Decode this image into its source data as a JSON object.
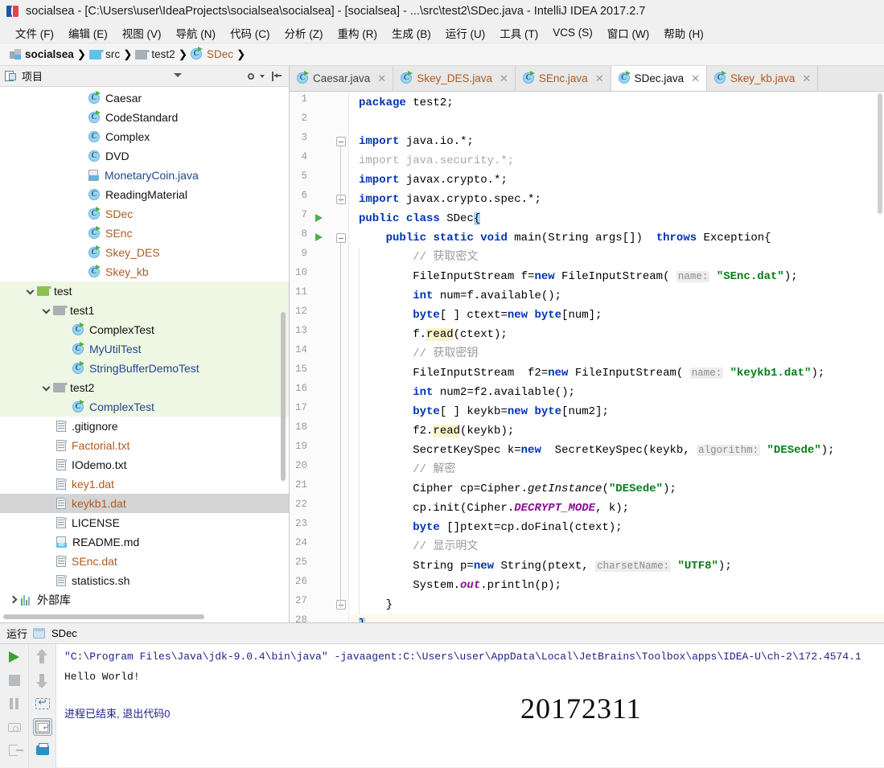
{
  "window": {
    "title": "socialsea - [C:\\Users\\user\\IdeaProjects\\socialsea\\socialsea] - [socialsea] - ...\\src\\test2\\SDec.java - IntelliJ IDEA 2017.2.7",
    "app_icon": "intellij-idea-icon"
  },
  "menubar": {
    "items": [
      "文件 (F)",
      "编辑 (E)",
      "视图 (V)",
      "导航 (N)",
      "代码 (C)",
      "分析 (Z)",
      "重构 (R)",
      "生成 (B)",
      "运行 (U)",
      "工具 (T)",
      "VCS (S)",
      "窗口 (W)",
      "帮助 (H)"
    ]
  },
  "breadcrumb": {
    "items": [
      {
        "label": "socialsea",
        "icon": "module-icon",
        "style": "bold"
      },
      {
        "label": "src",
        "icon": "folder-blue-icon",
        "style": "plain"
      },
      {
        "label": "test2",
        "icon": "folder-gray-icon",
        "style": "plain"
      },
      {
        "label": "SDec",
        "icon": "java-class-icon",
        "style": "orange"
      }
    ]
  },
  "project_panel": {
    "title": "项目",
    "icon": "project-view-icon",
    "dropdown_icon": "chevron-down-icon",
    "settings_icon": "gear-icon",
    "collapse_icon": "collapse-all-icon",
    "tree": [
      {
        "label": "Caesar",
        "icon": "java-class-runnable-icon",
        "indent": 5,
        "color": "dark",
        "bg": "none"
      },
      {
        "label": "CodeStandard",
        "icon": "java-class-runnable-icon",
        "indent": 5,
        "color": "dark",
        "bg": "none"
      },
      {
        "label": "Complex",
        "icon": "java-class-icon",
        "indent": 5,
        "color": "dark",
        "bg": "none"
      },
      {
        "label": "DVD",
        "icon": "java-class-icon",
        "indent": 5,
        "color": "dark",
        "bg": "none"
      },
      {
        "label": "MonetaryCoin.java",
        "icon": "java-file-icon",
        "indent": 5,
        "color": "blue",
        "bg": "none"
      },
      {
        "label": "ReadingMaterial",
        "icon": "java-class-icon",
        "indent": 5,
        "color": "dark",
        "bg": "none"
      },
      {
        "label": "SDec",
        "icon": "java-class-runnable-icon",
        "indent": 5,
        "color": "orange",
        "bg": "none"
      },
      {
        "label": "SEnc",
        "icon": "java-class-runnable-icon",
        "indent": 5,
        "color": "orange",
        "bg": "none"
      },
      {
        "label": "Skey_DES",
        "icon": "java-class-runnable-icon",
        "indent": 5,
        "color": "orange",
        "bg": "none"
      },
      {
        "label": "Skey_kb",
        "icon": "java-class-runnable-icon",
        "indent": 5,
        "color": "orange",
        "bg": "none"
      },
      {
        "label": "test",
        "icon": "folder-green-icon",
        "indent": 1,
        "color": "dark",
        "bg": "green",
        "twisty": "down"
      },
      {
        "label": "test1",
        "icon": "folder-gray-icon",
        "indent": 2,
        "color": "dark",
        "bg": "green",
        "twisty": "down"
      },
      {
        "label": "ComplexTest",
        "icon": "java-class-runnable-icon",
        "indent": 4,
        "color": "dark",
        "bg": "green"
      },
      {
        "label": "MyUtilTest",
        "icon": "java-class-runnable-icon",
        "indent": 4,
        "color": "blue",
        "bg": "green"
      },
      {
        "label": "StringBufferDemoTest",
        "icon": "java-class-runnable-icon",
        "indent": 4,
        "color": "blue",
        "bg": "green"
      },
      {
        "label": "test2",
        "icon": "folder-gray-icon",
        "indent": 2,
        "color": "dark",
        "bg": "green",
        "twisty": "down"
      },
      {
        "label": "ComplexTest",
        "icon": "java-class-runnable-icon",
        "indent": 4,
        "color": "blue",
        "bg": "green"
      },
      {
        "label": ".gitignore",
        "icon": "file-icon",
        "indent": 3,
        "color": "dark",
        "bg": "none"
      },
      {
        "label": "Factorial.txt",
        "icon": "file-icon",
        "indent": 3,
        "color": "orange",
        "bg": "none"
      },
      {
        "label": "IOdemo.txt",
        "icon": "file-icon",
        "indent": 3,
        "color": "dark",
        "bg": "none"
      },
      {
        "label": "key1.dat",
        "icon": "file-icon",
        "indent": 3,
        "color": "orange",
        "bg": "none"
      },
      {
        "label": "keykb1.dat",
        "icon": "file-icon",
        "indent": 3,
        "color": "orange",
        "bg": "selected"
      },
      {
        "label": "LICENSE",
        "icon": "file-icon",
        "indent": 3,
        "color": "dark",
        "bg": "none"
      },
      {
        "label": "README.md",
        "icon": "markdown-file-icon",
        "indent": 3,
        "color": "dark",
        "bg": "none"
      },
      {
        "label": "SEnc.dat",
        "icon": "file-icon",
        "indent": 3,
        "color": "orange",
        "bg": "none"
      },
      {
        "label": "statistics.sh",
        "icon": "file-icon",
        "indent": 3,
        "color": "dark",
        "bg": "none"
      },
      {
        "label": "外部库",
        "icon": "library-icon",
        "indent": 0,
        "color": "dark",
        "bg": "none",
        "twisty": "right"
      }
    ]
  },
  "editor": {
    "tabs": [
      {
        "label": "Caesar.java",
        "icon": "java-class-runnable-icon",
        "active": false,
        "color": "dark",
        "close_icon": "close-icon"
      },
      {
        "label": "Skey_DES.java",
        "icon": "java-class-runnable-icon",
        "active": false,
        "color": "orange",
        "close_icon": "close-icon"
      },
      {
        "label": "SEnc.java",
        "icon": "java-class-runnable-icon",
        "active": false,
        "color": "orange",
        "close_icon": "close-icon"
      },
      {
        "label": "SDec.java",
        "icon": "java-class-runnable-icon",
        "active": true,
        "color": "orange",
        "close_icon": "close-icon"
      },
      {
        "label": "Skey_kb.java",
        "icon": "java-class-runnable-icon",
        "active": false,
        "color": "orange",
        "close_icon": "close-icon"
      }
    ],
    "line_numbers": [
      1,
      2,
      3,
      4,
      5,
      6,
      7,
      8,
      9,
      10,
      11,
      12,
      13,
      14,
      15,
      16,
      17,
      18,
      19,
      20,
      21,
      22,
      23,
      24,
      25,
      26,
      27,
      28
    ],
    "current_line": 28,
    "code_lines": [
      {
        "n": 1,
        "text": "package test2;"
      },
      {
        "n": 2,
        "text": ""
      },
      {
        "n": 3,
        "text": "import java.io.*;"
      },
      {
        "n": 4,
        "text": "import java.security.*;"
      },
      {
        "n": 5,
        "text": "import javax.crypto.*;"
      },
      {
        "n": 6,
        "text": "import javax.crypto.spec.*;"
      },
      {
        "n": 7,
        "text": "public class SDec{"
      },
      {
        "n": 8,
        "text": "    public static void main(String args[])  throws Exception{"
      },
      {
        "n": 9,
        "text": "        // 获取密文"
      },
      {
        "n": 10,
        "text": "        FileInputStream f=new FileInputStream( name: \"SEnc.dat\");"
      },
      {
        "n": 11,
        "text": "        int num=f.available();"
      },
      {
        "n": 12,
        "text": "        byte[ ] ctext=new byte[num];"
      },
      {
        "n": 13,
        "text": "        f.read(ctext);"
      },
      {
        "n": 14,
        "text": "        // 获取密钥"
      },
      {
        "n": 15,
        "text": "        FileInputStream  f2=new FileInputStream( name: \"keykb1.dat\");"
      },
      {
        "n": 16,
        "text": "        int num2=f2.available();"
      },
      {
        "n": 17,
        "text": "        byte[ ] keykb=new byte[num2];"
      },
      {
        "n": 18,
        "text": "        f2.read(keykb);"
      },
      {
        "n": 19,
        "text": "        SecretKeySpec k=new  SecretKeySpec(keykb, algorithm: \"DESede\");"
      },
      {
        "n": 20,
        "text": "        // 解密"
      },
      {
        "n": 21,
        "text": "        Cipher cp=Cipher.getInstance(\"DESede\");"
      },
      {
        "n": 22,
        "text": "        cp.init(Cipher.DECRYPT_MODE, k);"
      },
      {
        "n": 23,
        "text": "        byte []ptext=cp.doFinal(ctext);"
      },
      {
        "n": 24,
        "text": "        // 显示明文"
      },
      {
        "n": 25,
        "text": "        String p=new String(ptext, charsetName: \"UTF8\");"
      },
      {
        "n": 26,
        "text": "        System.out.println(p);"
      },
      {
        "n": 27,
        "text": "    }"
      },
      {
        "n": 28,
        "text": "}"
      }
    ]
  },
  "run_panel": {
    "title": "运行",
    "tab_label": "SDec",
    "tab_icon": "run-configuration-icon",
    "toolbar_left": [
      {
        "name": "rerun-button",
        "icon": "play-icon"
      },
      {
        "name": "stop-button",
        "icon": "stop-icon"
      },
      {
        "name": "pause-button",
        "icon": "pause-icon"
      },
      {
        "name": "dump-button",
        "icon": "camera-icon"
      },
      {
        "name": "exit-button",
        "icon": "exit-icon"
      }
    ],
    "toolbar_right": [
      {
        "name": "scroll-up-button",
        "icon": "arrow-up-icon"
      },
      {
        "name": "scroll-down-button",
        "icon": "arrow-down-icon"
      },
      {
        "name": "soft-wrap-button",
        "icon": "wrap-text-icon"
      },
      {
        "name": "scroll-to-end-button",
        "icon": "scroll-to-end-icon"
      },
      {
        "name": "print-button",
        "icon": "printer-icon"
      }
    ],
    "console": {
      "command_line": "\"C:\\Program Files\\Java\\jdk-9.0.4\\bin\\java\" -javaagent:C:\\Users\\user\\AppData\\Local\\JetBrains\\Toolbox\\apps\\IDEA-U\\ch-2\\172.4574.1",
      "output": "Hello World!",
      "exit_message": "进程已结束, 退出代码0"
    }
  },
  "watermark": "20172311",
  "colors": {
    "accent": "#2d8ec9",
    "keyword": "#0033b3",
    "string": "#067d17",
    "comment": "#9a9a9a",
    "field": "#871094",
    "modified_file": "#b05a20",
    "test_root_bg": "#eef6e4",
    "selection": "#d4d4d4"
  }
}
